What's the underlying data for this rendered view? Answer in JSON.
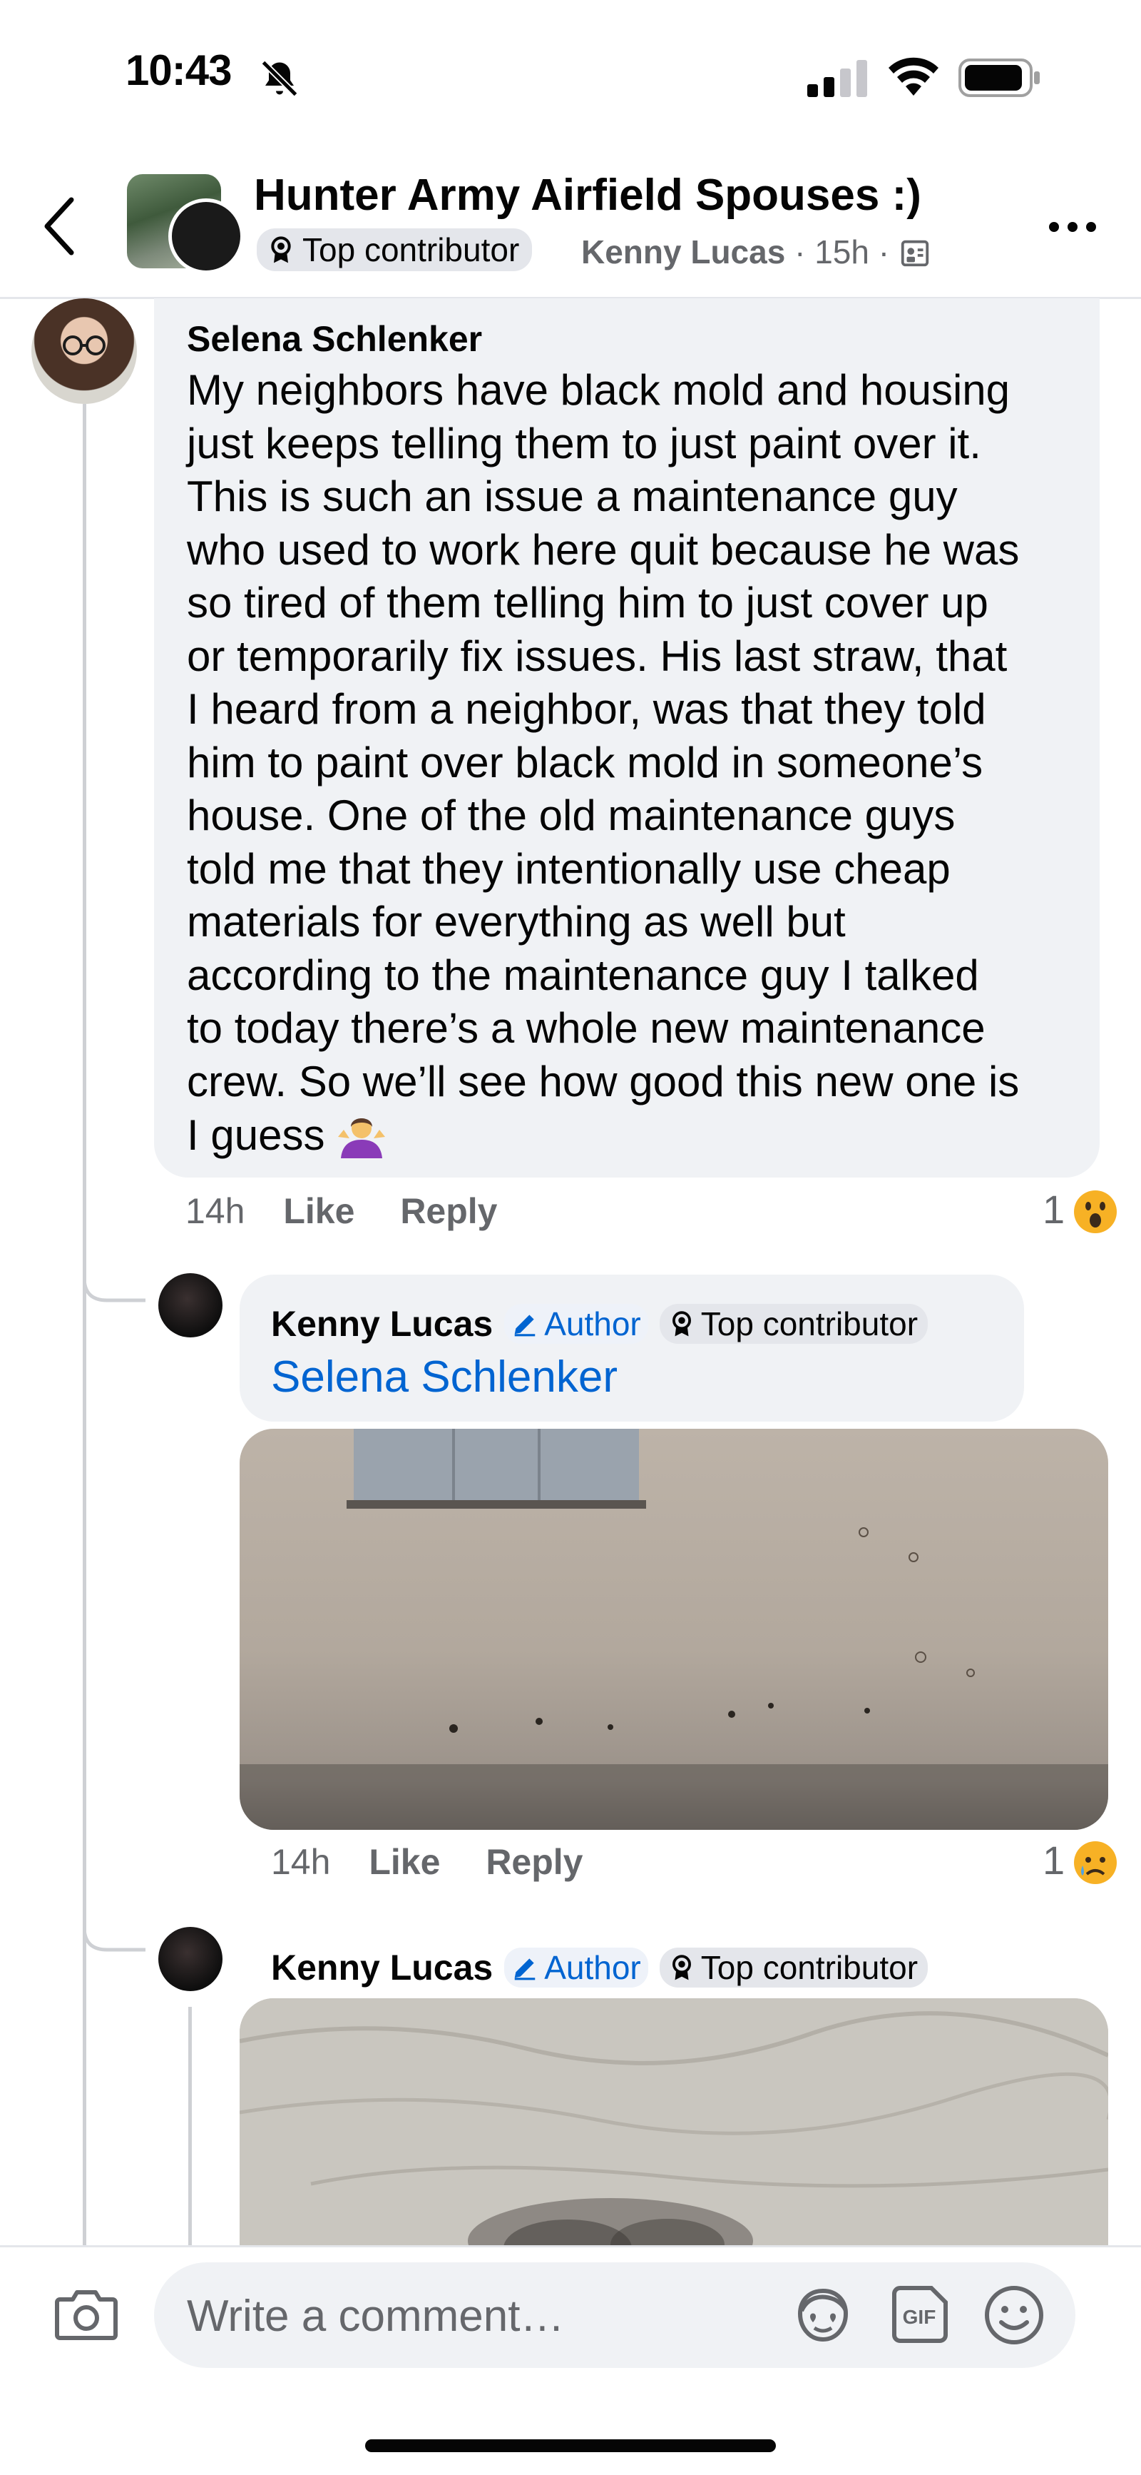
{
  "status_bar": {
    "time": "10:43"
  },
  "header": {
    "group_name": "Hunter Army Airfield Spouses :)",
    "badge": "Top contributor",
    "author": "Kenny Lucas",
    "time": "15h"
  },
  "comments": [
    {
      "name": "Selena Schlenker",
      "lines": [
        "My neighbors have black mold and housing",
        "just keeps telling them to just paint over it.",
        "This is such an issue a maintenance guy",
        "who used to work here quit because he was",
        "so tired of them telling him to just cover up",
        "or temporarily fix issues. His last straw, that",
        "I heard from a neighbor, was that they told",
        "him to paint over black mold in someone’s",
        "house. One of the old maintenance guys",
        "told me that they intentionally use cheap",
        "materials for everything as well but",
        "according to the maintenance guy I talked",
        "to today there’s a whole new maintenance",
        "crew. So we’ll see how good this new one is",
        "I guess"
      ],
      "emoji": "shrug-emoji",
      "time": "14h",
      "like": "Like",
      "reply": "Reply",
      "reaction_count": "1",
      "reaction": "wow"
    },
    {
      "name": "Kenny Lucas",
      "author_badge": "Author",
      "badge": "Top contributor",
      "mention": "Selena Schlenker",
      "image": "wall-with-mold-spots",
      "time": "14h",
      "like": "Like",
      "reply": "Reply",
      "reaction_count": "1",
      "reaction": "sad"
    },
    {
      "name": "Kenny Lucas",
      "author_badge": "Author",
      "badge": "Top contributor",
      "image": "textured-ceiling-black-mold"
    }
  ],
  "composer": {
    "placeholder": "Write a comment…"
  },
  "colors": {
    "link": "#0064d1",
    "bubble": "#f0f2f5",
    "muted": "#65676b"
  }
}
